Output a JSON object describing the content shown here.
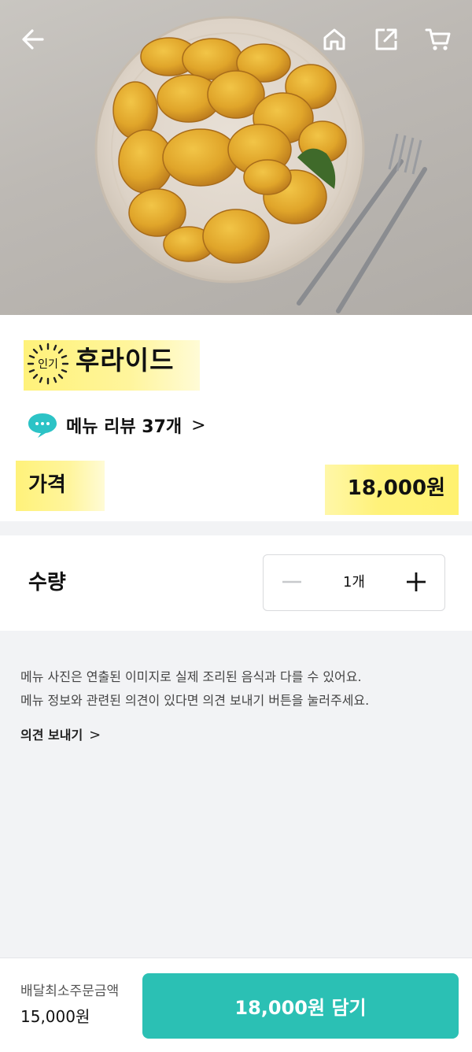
{
  "colors": {
    "accent": "#2bc0b4",
    "highlight": "#fff27a",
    "background": "#f2f3f5"
  },
  "header": {
    "back_icon": "arrow-left-icon",
    "home_icon": "home-icon",
    "share_icon": "share-icon",
    "cart_icon": "cart-icon"
  },
  "menu": {
    "badge": "인기",
    "title": "후라이드",
    "review_label": "메뉴 리뷰 37개",
    "review_chevron": ">",
    "price_label": "가격",
    "price_value": "18,000원"
  },
  "quantity": {
    "label": "수량",
    "value": "1개"
  },
  "notice": {
    "line1": "메뉴 사진은 연출된 이미지로 실제 조리된 음식과 다를 수 있어요.",
    "line2": "메뉴 정보와 관련된 의견이 있다면 의견 보내기 버튼을 눌러주세요.",
    "feedback_label": "의견 보내기",
    "feedback_chevron": ">"
  },
  "footer": {
    "min_order_label": "배달최소주문금액",
    "min_order_value": "15,000원",
    "cart_button_label": "18,000원 담기"
  }
}
